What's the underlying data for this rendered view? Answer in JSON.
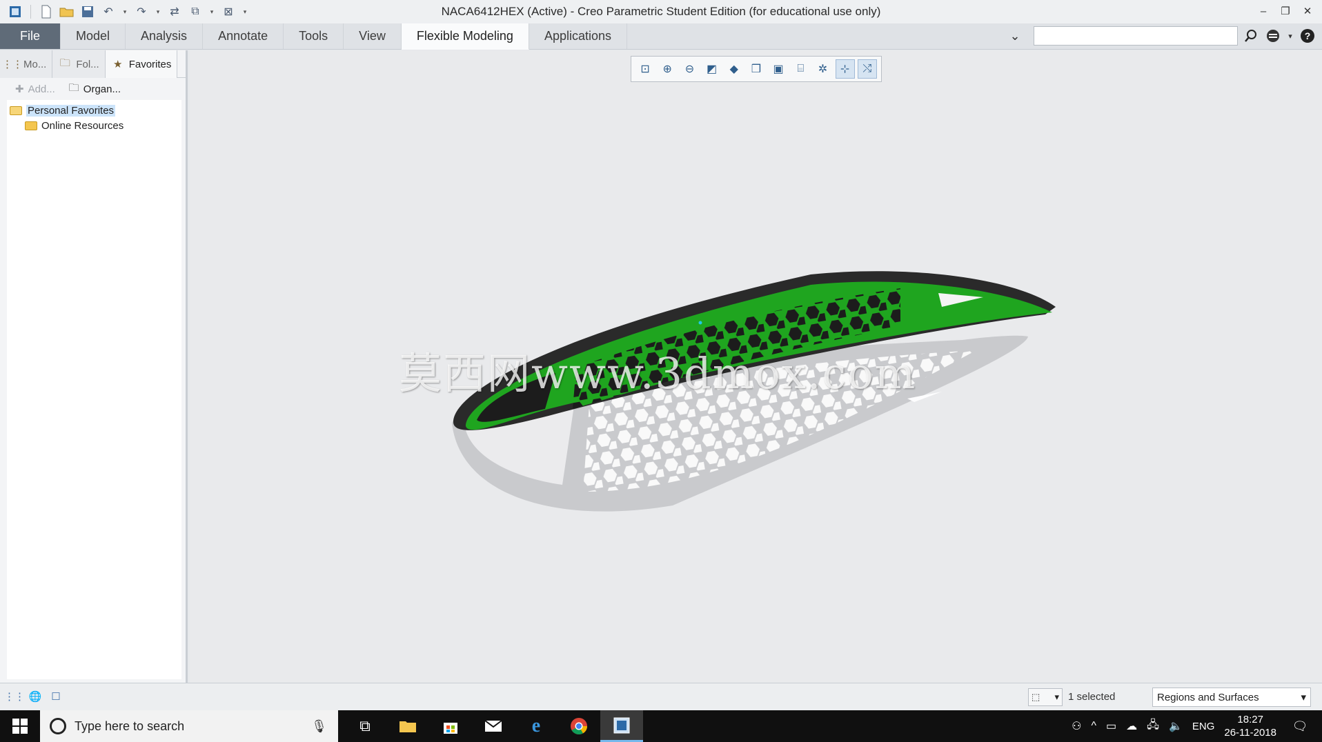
{
  "window": {
    "title": "NACA6412HEX (Active) - Creo Parametric Student Edition (for educational use only)",
    "controls": {
      "minimize": "–",
      "restore": "❐",
      "close": "✕"
    }
  },
  "quick_access": [
    "app-icon",
    "new-icon",
    "open-icon",
    "save-icon",
    "undo-icon",
    "redo-icon",
    "regenerate-icon",
    "windows-icon",
    "close-window-icon",
    "customize-icon"
  ],
  "ribbon": {
    "tabs": [
      {
        "label": "File"
      },
      {
        "label": "Model"
      },
      {
        "label": "Analysis"
      },
      {
        "label": "Annotate"
      },
      {
        "label": "Tools"
      },
      {
        "label": "View"
      },
      {
        "label": "Flexible Modeling"
      },
      {
        "label": "Applications"
      }
    ],
    "active_tab": "Flexible Modeling",
    "search": {
      "value": "",
      "placeholder": ""
    }
  },
  "left_panel": {
    "tabs": [
      {
        "label": "Mo...",
        "icon": "model-tree-icon"
      },
      {
        "label": "Fol...",
        "icon": "folder-browser-icon"
      },
      {
        "label": "Favorites",
        "icon": "favorites-icon"
      }
    ],
    "toolbar": {
      "add": "Add...",
      "organize": "Organ..."
    },
    "tree": [
      {
        "label": "Personal Favorites",
        "selected": true,
        "open": true
      },
      {
        "label": "Online Resources",
        "selected": false,
        "open": false
      }
    ]
  },
  "graphics_toolbar": [
    "refit-icon",
    "zoom-in-icon",
    "zoom-out-icon",
    "repaint-icon",
    "display-style-icon",
    "saved-orientations-icon",
    "view-manager-icon",
    "perspective-icon",
    "datum-display-icon",
    "spin-center-icon",
    "annotation-display-icon"
  ],
  "viewport": {
    "watermark": "莫西网www.3dmox.com",
    "model_color": "#1fa51f",
    "model_dark": "#2a2a2a",
    "background": "#e9eaec"
  },
  "status_bar": {
    "selected_text": "1 selected",
    "filter_value": "Regions and Surfaces"
  },
  "taskbar": {
    "search_placeholder": "Type here to search",
    "language": "ENG",
    "time": "18:27",
    "date": "26-11-2018"
  }
}
